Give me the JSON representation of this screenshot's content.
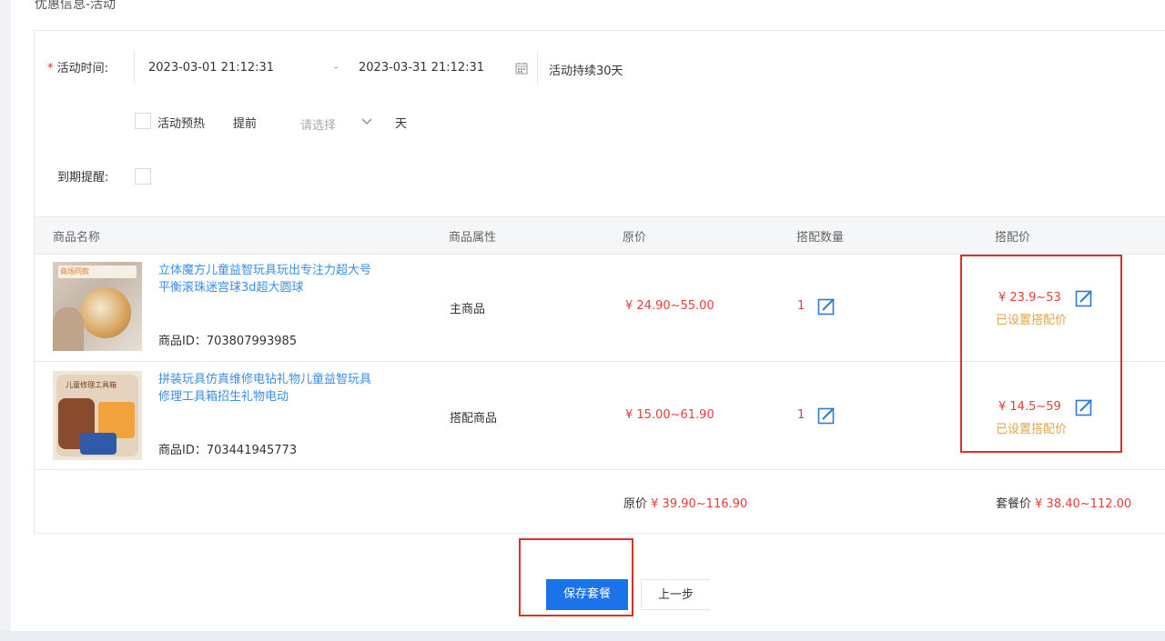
{
  "section_title": "优惠信息-活动",
  "activity_time": {
    "label": "活动时间:",
    "required_mark": "*",
    "start": "2023-03-01 21:12:31",
    "separator": "-",
    "end": "2023-03-31 21:12:31",
    "duration": "活动持续30天"
  },
  "preheat": {
    "checkbox_label": "活动预热",
    "advance_label": "提前",
    "select_placeholder": "请选择",
    "unit": "天"
  },
  "expire_reminder": {
    "label": "到期提醒:"
  },
  "table": {
    "headers": [
      "商品名称",
      "商品属性",
      "原价",
      "搭配数量",
      "搭配价"
    ],
    "rows": [
      {
        "title_line1": "立体魔方儿童益智玩具玩出专注力超大号",
        "title_line2": "平衡滚珠迷宫球3d超大圆球",
        "product_id": "商品ID：703807993985",
        "attribute": "主商品",
        "original_price": "¥ 24.90~55.00",
        "quantity": "1",
        "bundle_price": "¥ 23.9~53",
        "bundle_status": "已设置搭配价",
        "thumb_text": "商场同款"
      },
      {
        "title_line1": "拼装玩具仿真维修电钻礼物儿童益智玩具",
        "title_line2": "修理工具箱招生礼物电动",
        "product_id": "商品ID：703441945773",
        "attribute": "搭配商品",
        "original_price": "¥ 15.00~61.90",
        "quantity": "1",
        "bundle_price": "¥ 14.5~59",
        "bundle_status": "已设置搭配价",
        "thumb_text": "儿童修理工具箱"
      }
    ],
    "summary": {
      "original_label": "原价",
      "original_value": "¥ 39.90~116.90",
      "set_label": "套餐价",
      "set_value": "¥ 38.40~112.00"
    }
  },
  "buttons": {
    "save": "保存套餐",
    "prev": "上一步"
  },
  "colors": {
    "accent": "#1a73e8",
    "price_red": "#e0403a",
    "status_orange": "#e5a445",
    "highlight_box": "#d9322b",
    "link_blue": "#3a8ee6"
  }
}
